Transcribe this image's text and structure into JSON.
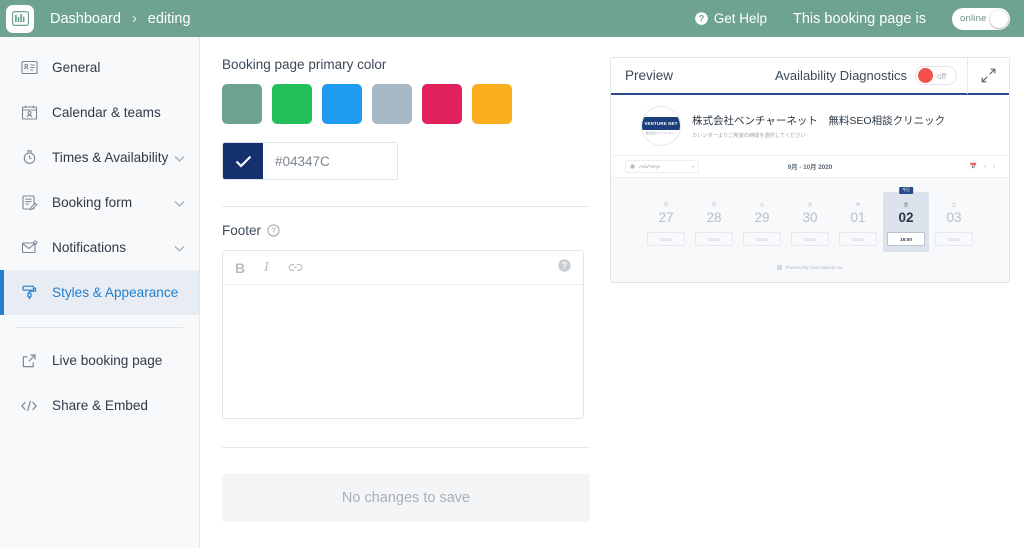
{
  "header": {
    "logo_icon": "bar-chart-logo-icon",
    "breadcrumb": {
      "root": "Dashboard",
      "separator": "›",
      "current": "editing"
    },
    "get_help": "Get Help",
    "help_icon": "question-circle-icon",
    "status_label": "This booking page is",
    "status_toggle": {
      "value": "online",
      "state": "on"
    }
  },
  "sidebar": {
    "items": [
      {
        "label": "General",
        "icon": "contact-card-icon",
        "expandable": false,
        "active": false
      },
      {
        "label": "Calendar & teams",
        "icon": "calendar-person-icon",
        "expandable": false,
        "active": false
      },
      {
        "label": "Times & Availability",
        "icon": "clock-icon",
        "expandable": true,
        "active": false
      },
      {
        "label": "Booking form",
        "icon": "form-pencil-icon",
        "expandable": true,
        "active": false
      },
      {
        "label": "Notifications",
        "icon": "envelope-icon",
        "expandable": true,
        "active": false
      },
      {
        "label": "Styles & Appearance",
        "icon": "paint-roller-icon",
        "expandable": false,
        "active": true
      }
    ],
    "footer_items": [
      {
        "label": "Live booking page",
        "icon": "external-link-icon"
      },
      {
        "label": "Share & Embed",
        "icon": "code-brackets-icon"
      }
    ]
  },
  "main": {
    "primary_color": {
      "label": "Booking page primary color",
      "swatches": [
        "#6fa391",
        "#22bf5b",
        "#1f9bf0",
        "#a8b8c5",
        "#e0215c",
        "#fbad20"
      ],
      "selected_hex": "#04347C",
      "selected_swatch_color": "#14306e",
      "check_icon": "check-icon"
    },
    "footer": {
      "label": "Footer",
      "help_icon": "question-circle-icon",
      "toolbar": [
        {
          "label": "B",
          "name": "bold-button"
        },
        {
          "label": "I",
          "name": "italic-button"
        },
        {
          "label": "ὑ7",
          "name": "link-button"
        }
      ],
      "toolbar_help_icon": "question-circle-filled-icon",
      "content": ""
    },
    "save_button": {
      "label": "No changes to save",
      "enabled": false
    }
  },
  "preview": {
    "title": "Preview",
    "diagnostics_label": "Availability Diagnostics",
    "diagnostics_toggle": {
      "value": "off",
      "state": "off",
      "color": "#f4514e"
    },
    "expand_icon": "expand-diagonal-icon",
    "booking_page": {
      "logo_text": "VENTURE NET",
      "logo_subtext": "株式会社ベンチャーネット",
      "title": "株式会社ベンチャーネット　無料SEO相談クリニック",
      "subtitle": "カレンダーよりご希望の時間を選択してください",
      "timezone": "Asia/Tokyo",
      "timezone_icon": "globe-icon",
      "month_range": "9月 - 10月 2020",
      "calendar_icon": "calendar-icon",
      "prev_icon": "chevron-left-icon",
      "next_icon": "chevron-right-icon",
      "today_badge": "今日",
      "days": [
        {
          "dow": "日",
          "date": "27",
          "slot": "16:00",
          "selected": false
        },
        {
          "dow": "月",
          "date": "28",
          "slot": "16:00",
          "selected": false
        },
        {
          "dow": "火",
          "date": "29",
          "slot": "16:00",
          "selected": false
        },
        {
          "dow": "水",
          "date": "30",
          "slot": "16:00",
          "selected": false
        },
        {
          "dow": "木",
          "date": "01",
          "slot": "16:00",
          "selected": false
        },
        {
          "dow": "金",
          "date": "02",
          "slot": "16:00",
          "selected": true
        },
        {
          "dow": "土",
          "date": "03",
          "slot": "16:00",
          "selected": false
        }
      ],
      "powered_by": "Powered by YouCanBook.me"
    }
  }
}
